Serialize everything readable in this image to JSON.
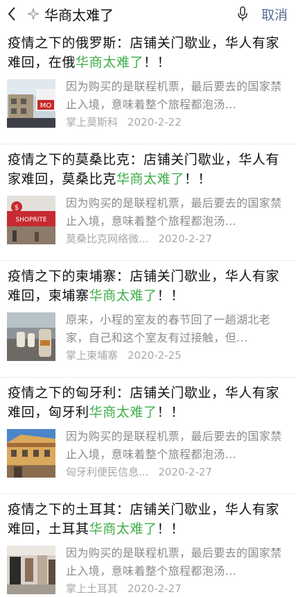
{
  "search": {
    "query": "华商太难了",
    "cancel_label": "取消"
  },
  "results": [
    {
      "title_prefix": "疫情之下的俄罗斯：店铺关门歇业，华人有家难回，在俄",
      "title_highlight": "华商太难了",
      "title_suffix": "！！",
      "snippet": "因为购买的是联程机票，最后要去的国家禁止入境，意味着整个旅程都泡汤...",
      "source": "掌上莫斯科",
      "date": "2020-2-22",
      "thumb_text": "MO"
    },
    {
      "title_prefix": "疫情之下的莫桑比克：店铺关门歇业，华人有家难回，莫桑比克",
      "title_highlight": "华商太难了",
      "title_suffix": "！！",
      "snippet": "因为购买的是联程机票，最后要去的国家禁止入境，意味着整个旅程都泡汤...",
      "source": "莫桑比克网络微...",
      "date": "2020-2-27",
      "thumb_text": "SHOPRITE"
    },
    {
      "title_prefix": "疫情之下的柬埔寨：店铺关门歇业，华人有家难回，柬埔寨",
      "title_highlight": "华商太难了",
      "title_suffix": "！！",
      "snippet": "原来，小程的室友的春节回了一趟湖北老家，自己和这个室友有过接触，但...",
      "source": "掌上柬埔寨",
      "date": "2020-2-25",
      "thumb_text": ""
    },
    {
      "title_prefix": "疫情之下的匈牙利：店铺关门歇业，华人有家难回，匈牙利",
      "title_highlight": "华商太难了",
      "title_suffix": "！！",
      "snippet": "因为购买的是联程机票，最后要去的国家禁止入境，意味着整个旅程都泡汤...",
      "source": "匈牙利便民信息...",
      "date": "2020-2-27",
      "thumb_text": ""
    },
    {
      "title_prefix": "疫情之下的土耳其：店铺关门歇业，华人有家难回，土耳其",
      "title_highlight": "华商太难了",
      "title_suffix": "！！",
      "snippet": "因为购买的是联程机票，最后要去的国家禁止入境，意味着整个旅程都泡汤...",
      "source": "掌上土耳其",
      "date": "2020-2-27",
      "thumb_text": ""
    }
  ],
  "colors": {
    "highlight": "#3fae49",
    "link": "#576b95",
    "muted": "#8a8a8a"
  },
  "icons": {
    "back": "chevron-left-icon",
    "search_badge": "sparkle-icon",
    "voice": "microphone-icon"
  }
}
